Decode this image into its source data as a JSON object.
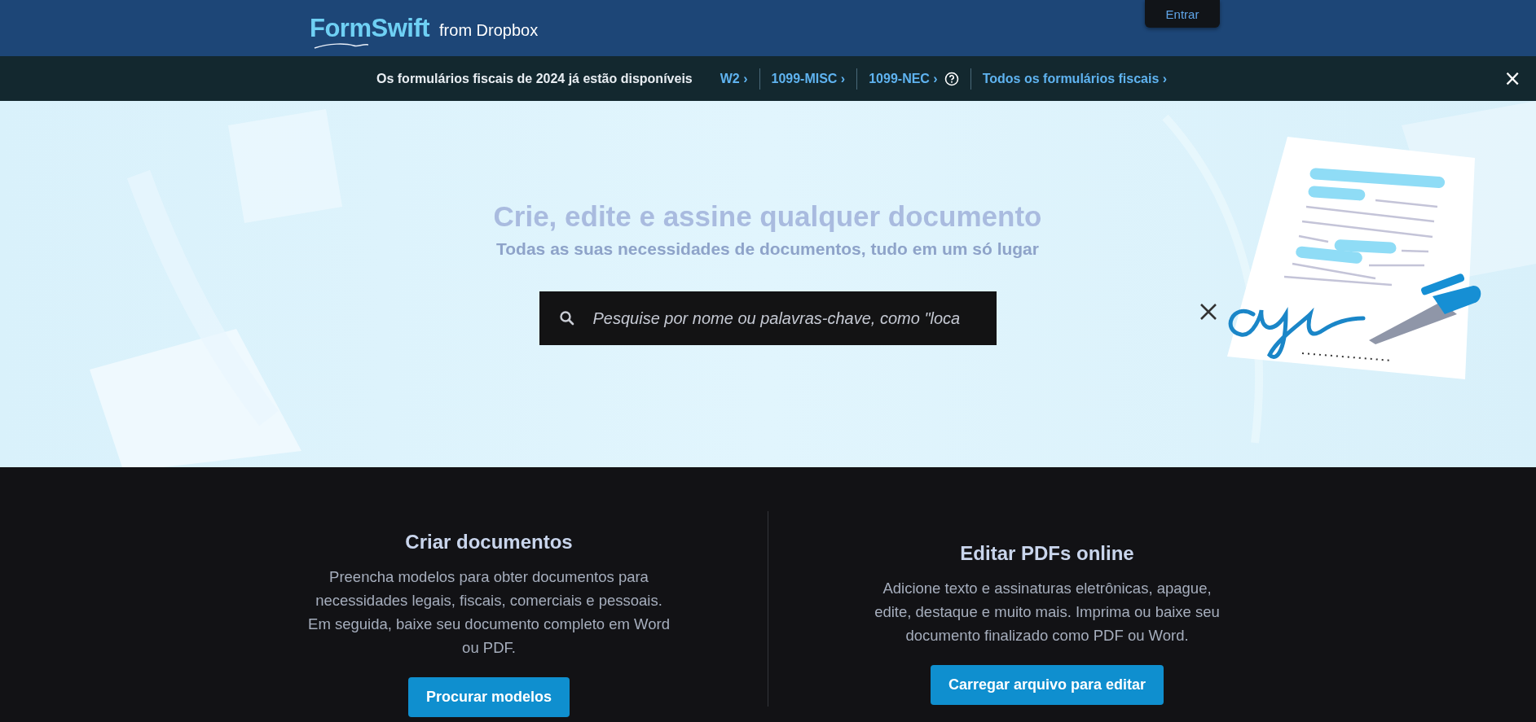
{
  "header": {
    "logo": "FormSwift",
    "logo_suffix": "from Dropbox",
    "login_button": "Entrar"
  },
  "banner": {
    "message": "Os formulários fiscais de 2024 já estão disponíveis",
    "links": [
      {
        "label": "W2 ›",
        "help": false
      },
      {
        "label": "1099-MISC ›",
        "help": false
      },
      {
        "label": "1099-NEC ›",
        "help": true
      },
      {
        "label": "Todos os formulários fiscais ›",
        "help": false
      }
    ],
    "close": "×"
  },
  "hero": {
    "title": "Crie, edite e assine qualquer documento",
    "subtitle": "Todas as suas necessidades de documentos, tudo em um só lugar",
    "search": {
      "placeholder": "Pesquise por nome ou palavras-chave, como \"loca"
    }
  },
  "features": [
    {
      "title": "Criar documentos",
      "description": "Preencha modelos para obter documentos para necessidades legais, fiscais, comerciais e pessoais. Em seguida, baixe seu documento completo em Word ou PDF.",
      "button": "Procurar modelos"
    },
    {
      "title": "Editar PDFs online",
      "description": "Adicione texto e assinaturas eletrônicas, apague, edite, destaque e muito mais. Imprima ou baixe seu documento finalizado como PDF ou Word.",
      "button": "Carregar arquivo para editar"
    }
  ]
}
